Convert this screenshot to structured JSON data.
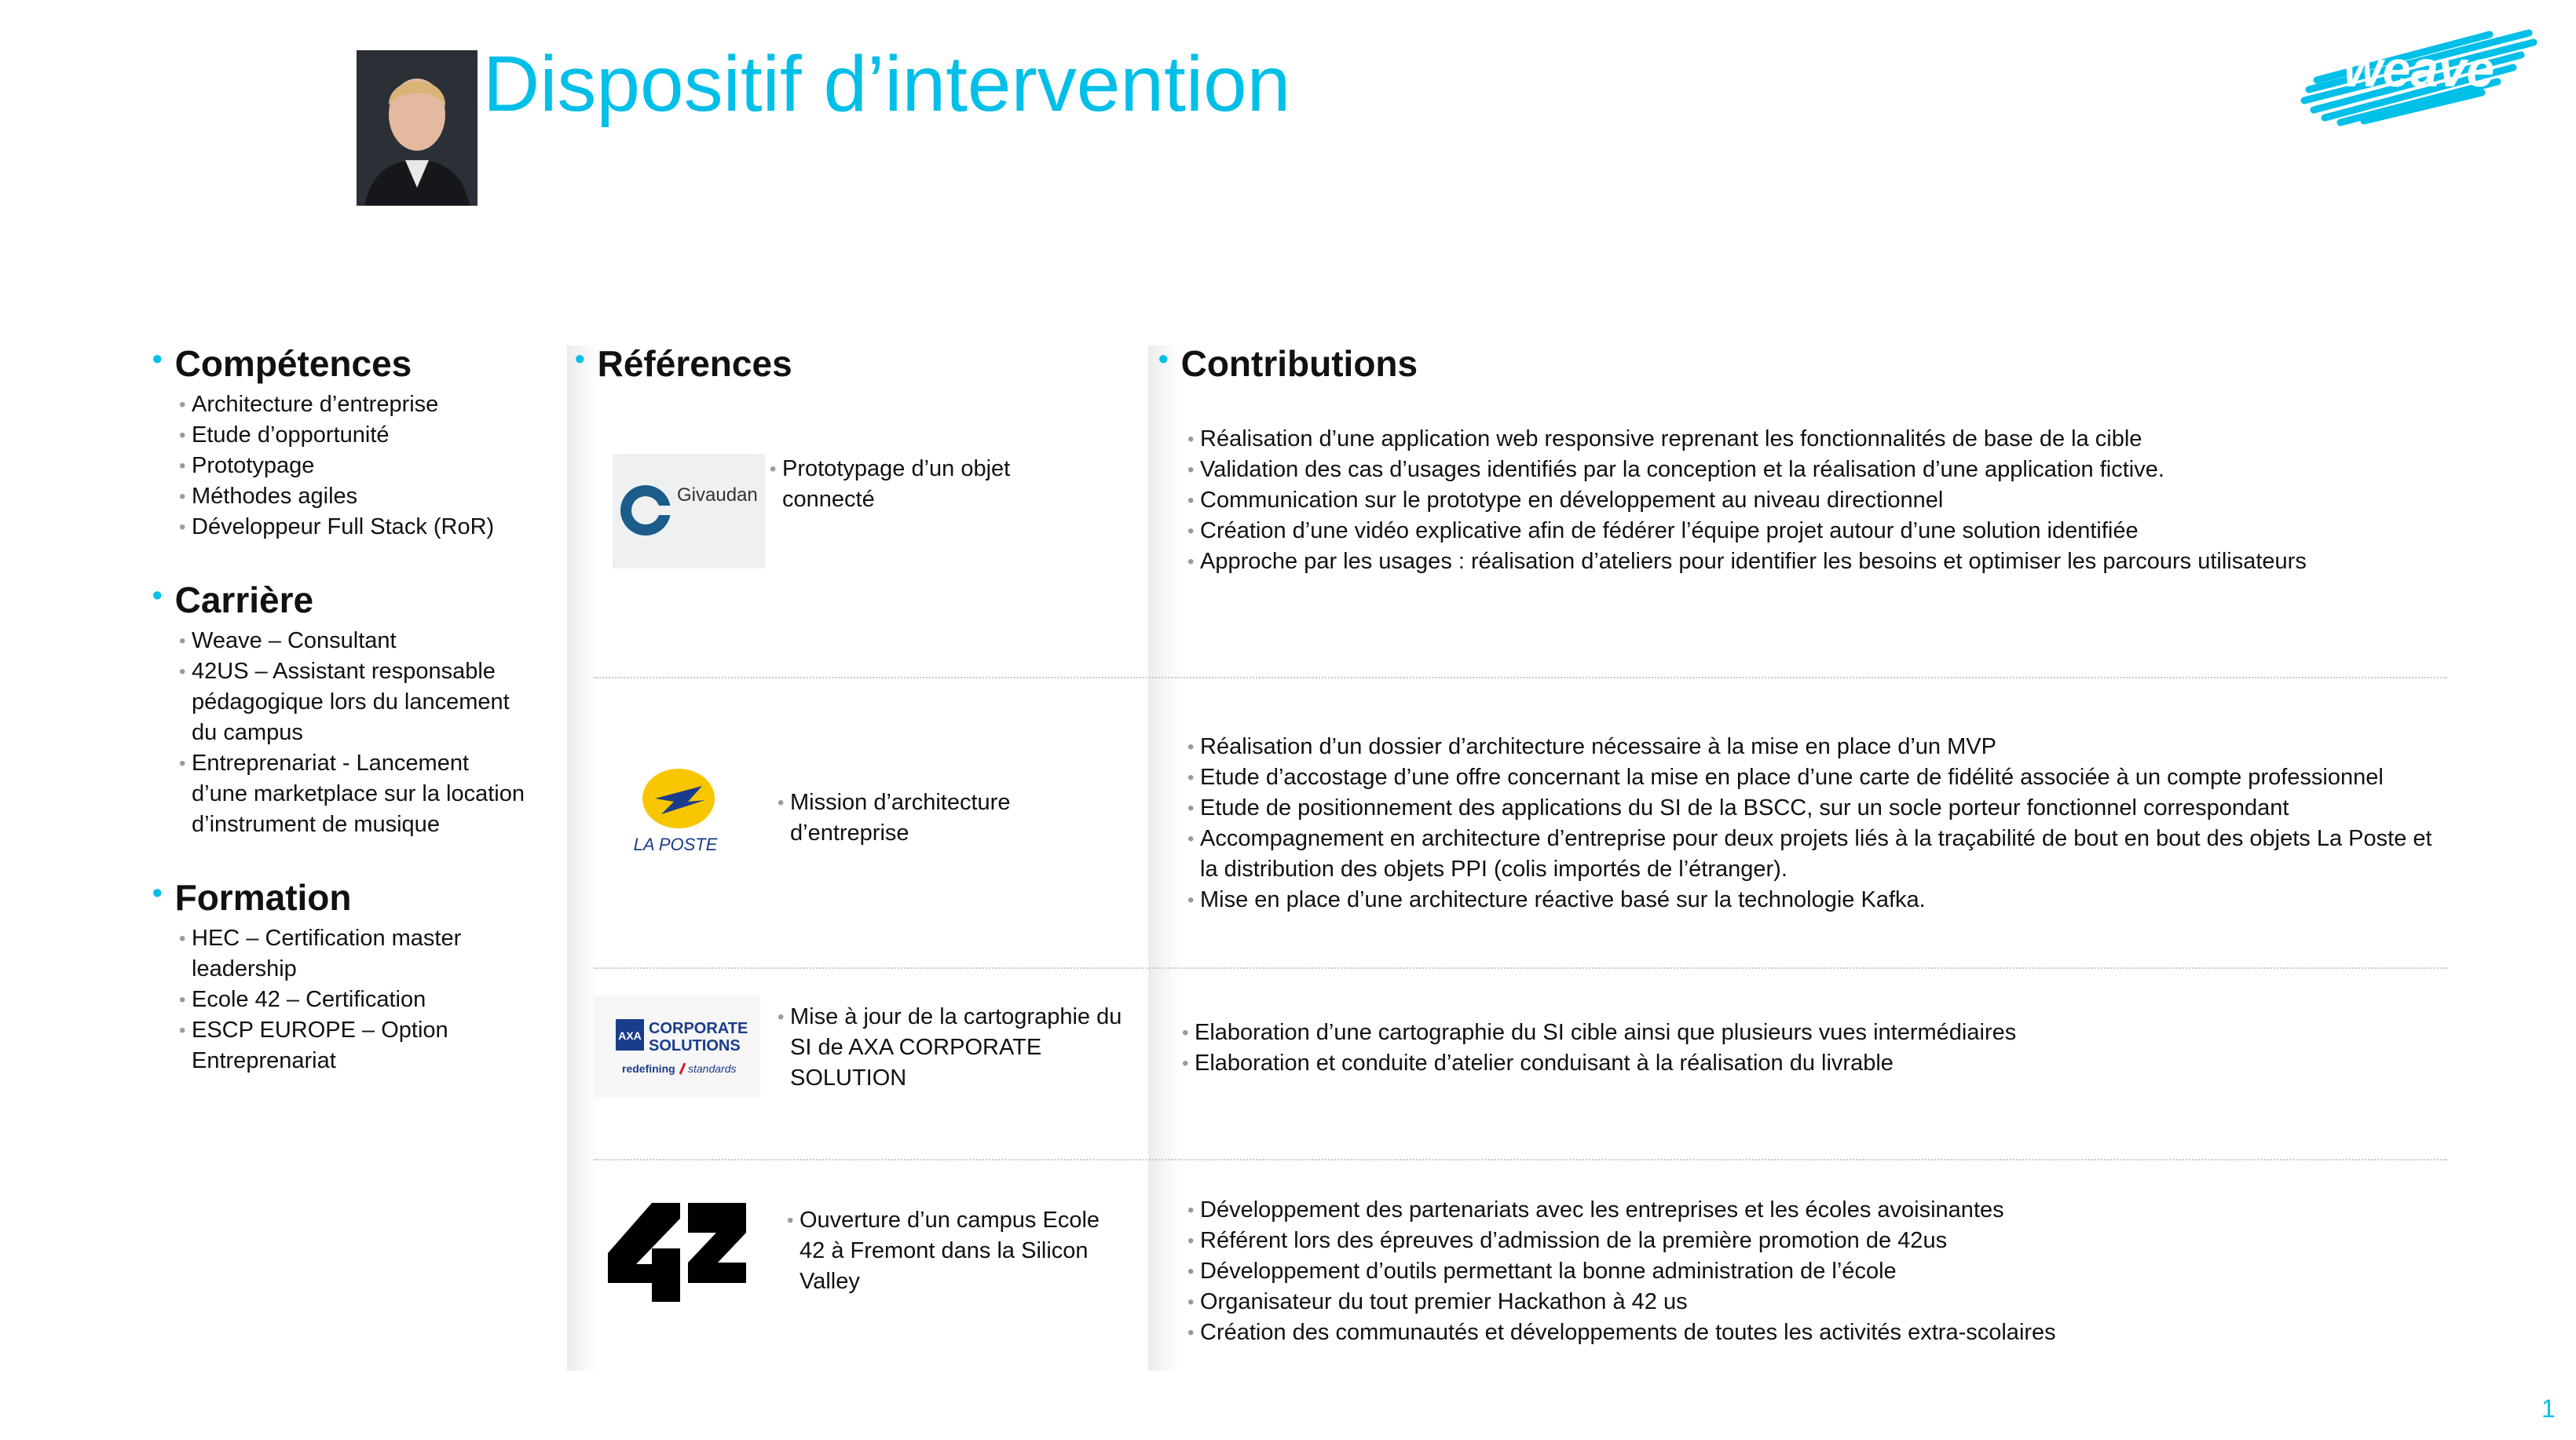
{
  "header": {
    "title": "Dispositif d’intervention",
    "brand": "weave"
  },
  "colors": {
    "accent": "#00bfe8",
    "bullet_grey": "#9a9a9a",
    "separator": "#c8c8c8"
  },
  "left": {
    "competences": {
      "heading": "Compétences",
      "items": [
        "Architecture d’entreprise",
        "Etude d’opportunité",
        "Prototypage",
        "Méthodes agiles",
        "Développeur Full Stack (RoR)"
      ]
    },
    "carriere": {
      "heading": "Carrière",
      "items": [
        "Weave – Consultant",
        "42US – Assistant responsable pédagogique lors du lancement du campus",
        "Entreprenariat - Lancement d’une marketplace sur la location d’instrument de musique"
      ]
    },
    "formation": {
      "heading": "Formation",
      "items": [
        "HEC – Certification master leadership",
        "Ecole 42 – Certification",
        "ESCP EUROPE – Option Entreprenariat"
      ]
    }
  },
  "references_heading": "Références",
  "contributions_heading": "Contributions",
  "rows": [
    {
      "logo": {
        "text": "Givaudan"
      },
      "reference": "Prototypage d’un objet connecté",
      "contributions": [
        "Réalisation d’une application web responsive reprenant les fonctionnalités de base de la cible",
        "Validation des cas d’usages identifiés par la conception et la réalisation d’une application fictive.",
        "Communication sur le prototype en développement au niveau directionnel",
        "Création d’une vidéo explicative afin de fédérer l’équipe projet autour d’une solution identifiée",
        "Approche par les usages : réalisation d’ateliers pour identifier les besoins et optimiser les parcours utilisateurs"
      ]
    },
    {
      "logo": {
        "text": "LA POSTE"
      },
      "reference": "Mission d’architecture d’entreprise",
      "contributions": [
        "Réalisation d’un dossier d’architecture nécessaire à la mise en place d’un MVP",
        "Etude d’accostage d’une offre concernant la mise en place d’une carte de fidélité associée à un compte professionnel",
        "Etude de positionnement des applications du SI de la BSCC, sur un socle porteur fonctionnel correspondant",
        "Accompagnement en architecture d’entreprise pour deux projets liés à la traçabilité de bout en bout des objets La Poste et la distribution des objets PPI (colis importés de l’étranger).",
        "Mise en place d’une architecture réactive basé sur la technologie Kafka."
      ]
    },
    {
      "logo": {
        "brand": "AXA",
        "line1": "CORPORATE",
        "line2": "SOLUTIONS",
        "tag_a": "redefining",
        "tag_b": "standards"
      },
      "reference": "Mise à jour de la cartographie du SI de AXA CORPORATE SOLUTION",
      "contributions": [
        "Elaboration d’une cartographie du SI cible ainsi que plusieurs vues intermédiaires",
        "Elaboration et conduite d’atelier conduisant à la réalisation du livrable"
      ]
    },
    {
      "logo": {
        "text": "42"
      },
      "reference": "Ouverture d’un campus Ecole 42 à Fremont dans la  Silicon Valley",
      "contributions": [
        "Développement des partenariats avec les entreprises et les écoles avoisinantes",
        "Référent lors des épreuves d’admission de la première promotion de 42us",
        "Développement d’outils permettant la bonne administration de l’école",
        "Organisateur du tout premier Hackathon à 42 us",
        "Création des communautés et développements de toutes les activités extra-scolaires"
      ]
    }
  ],
  "page_number": "1"
}
